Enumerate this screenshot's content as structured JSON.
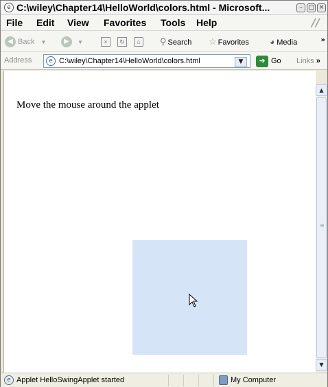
{
  "window": {
    "title": "C:\\wiley\\Chapter14\\HelloWorld\\colors.html - Microsoft..."
  },
  "menu": {
    "items": [
      {
        "label": "File"
      },
      {
        "label": "Edit"
      },
      {
        "label": "View"
      },
      {
        "label": "Favorites"
      },
      {
        "label": "Tools"
      },
      {
        "label": "Help"
      }
    ]
  },
  "toolbar": {
    "back_label": "Back",
    "search_label": "Search",
    "favorites_label": "Favorites",
    "media_label": "Media"
  },
  "address": {
    "label": "Address",
    "value": "C:\\wiley\\Chapter14\\HelloWorld\\colors.html",
    "go_label": "Go",
    "links_label": "Links"
  },
  "content": {
    "text": "Move the mouse around the applet",
    "applet_color": "#d6e4f7"
  },
  "status": {
    "text": "Applet HelloSwingApplet started",
    "zone": "My Computer"
  },
  "icons": {
    "ie_page": "ie-page-icon",
    "minimize": "minimize-icon",
    "maximize": "maximize-icon",
    "close": "close-icon"
  }
}
